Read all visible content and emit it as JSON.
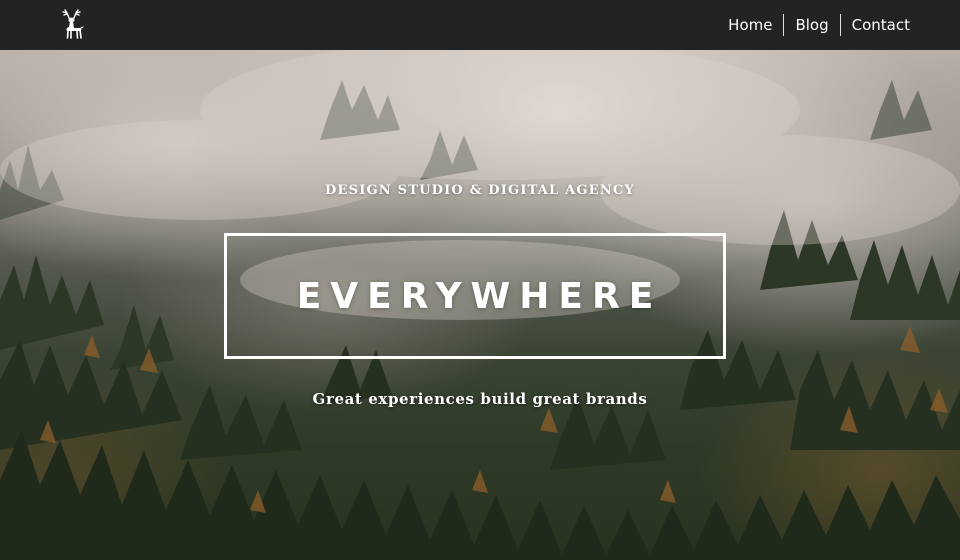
{
  "nav": {
    "logo_icon": "deer-icon",
    "links": [
      {
        "label": "Home"
      },
      {
        "label": "Blog"
      },
      {
        "label": "Contact"
      }
    ]
  },
  "hero": {
    "tagline": "DESIGN STUDIO & DIGITAL AGENCY",
    "headline": "EVERYWHERE",
    "subline": "Great experiences build great brands",
    "background_icon": "misty-forest-image"
  },
  "colors": {
    "navbar_bg": "#232323",
    "text": "#ffffff",
    "forest_dark": "#2e3a27",
    "fog": "#d6cdc6",
    "autumn": "#9c6b2e"
  }
}
